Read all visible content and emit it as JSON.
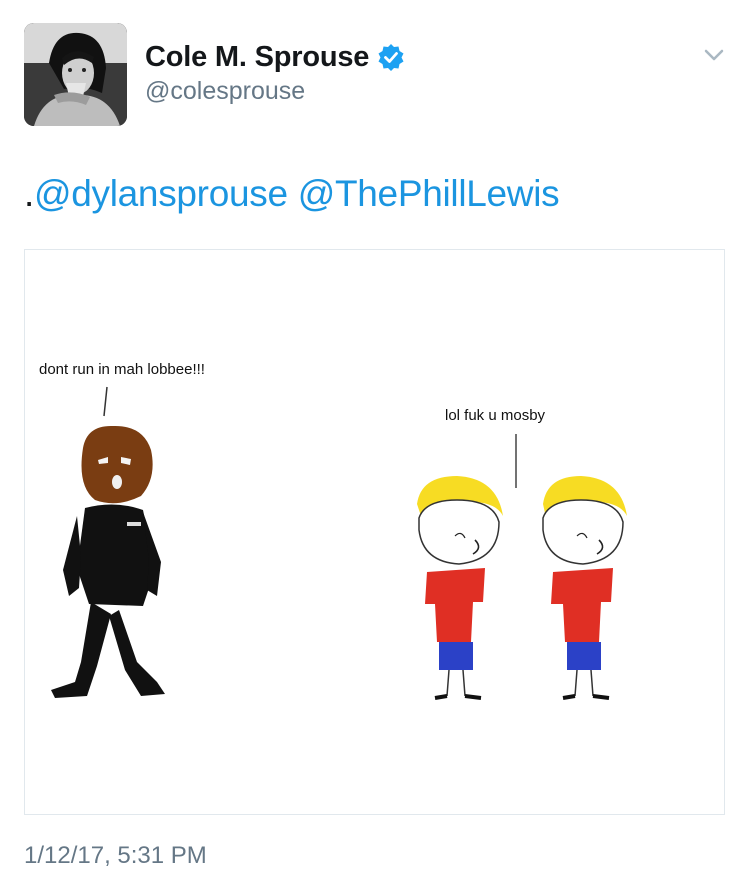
{
  "tweet": {
    "author": {
      "display_name": "Cole M. Sprouse",
      "handle": "@colesprouse",
      "verified": true,
      "avatar_icon": "profile-photo"
    },
    "menu_icon": "chevron-down-icon",
    "text_prefix": ".",
    "mentions": [
      "@dylansprouse",
      "@ThePhillLewis"
    ],
    "media": {
      "speech_left": "dont run in mah lobbee!!!",
      "speech_right": "lol fuk u mosby"
    },
    "timestamp": "1/12/17, 5:31 PM"
  },
  "colors": {
    "link": "#1b95e0",
    "verified_badge": "#1da1f2",
    "secondary_text": "#657786"
  }
}
